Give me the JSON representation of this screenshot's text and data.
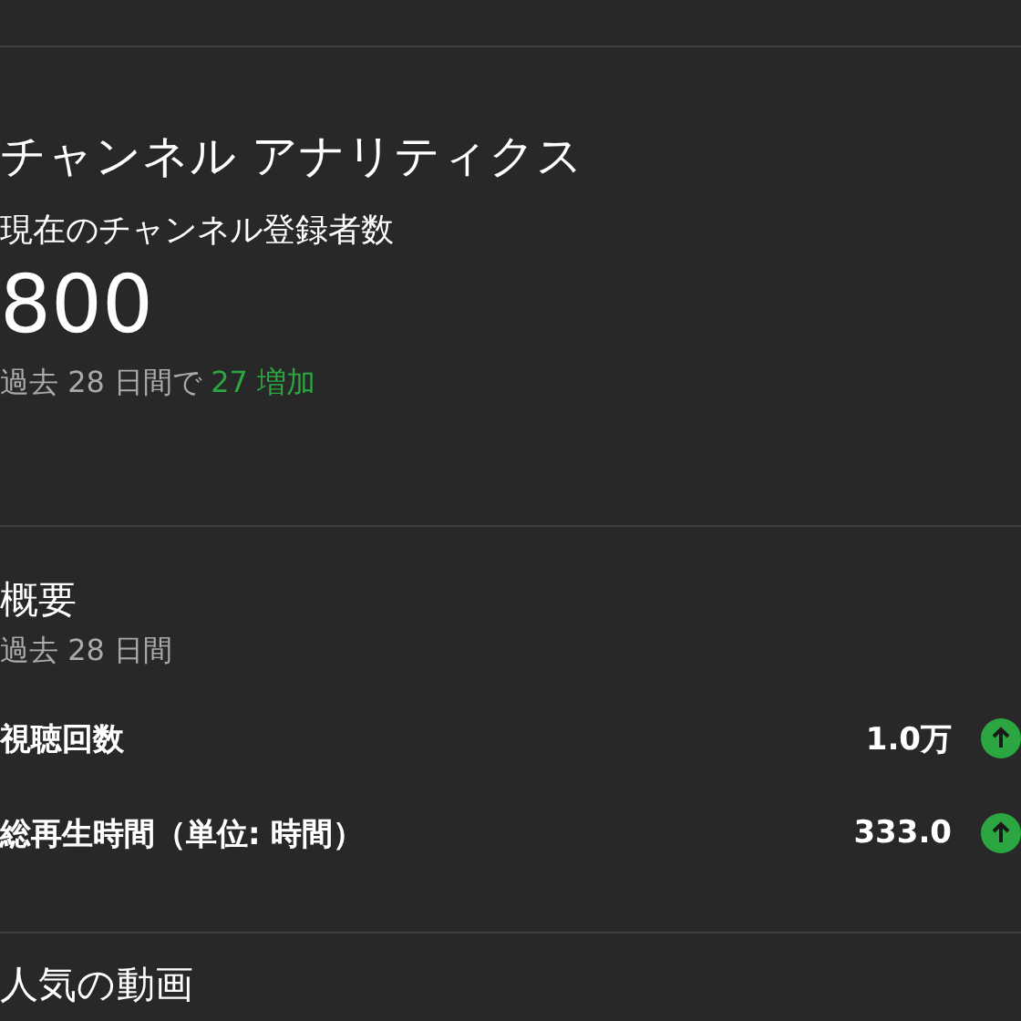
{
  "title": "チャンネル アナリティクス",
  "subscribers": {
    "label": "現在のチャンネル登録者数",
    "value": "800",
    "period": "過去 28 日間で",
    "change": "27 増加"
  },
  "summary": {
    "title": "概要",
    "period": "過去 28 日間",
    "metrics": [
      {
        "label": "視聴回数",
        "value": "1.0万",
        "increased": true
      },
      {
        "label": "総再生時間（単位: 時間）",
        "value": "333.0",
        "increased": true
      }
    ]
  },
  "next_section": {
    "title": "人気の動画"
  }
}
